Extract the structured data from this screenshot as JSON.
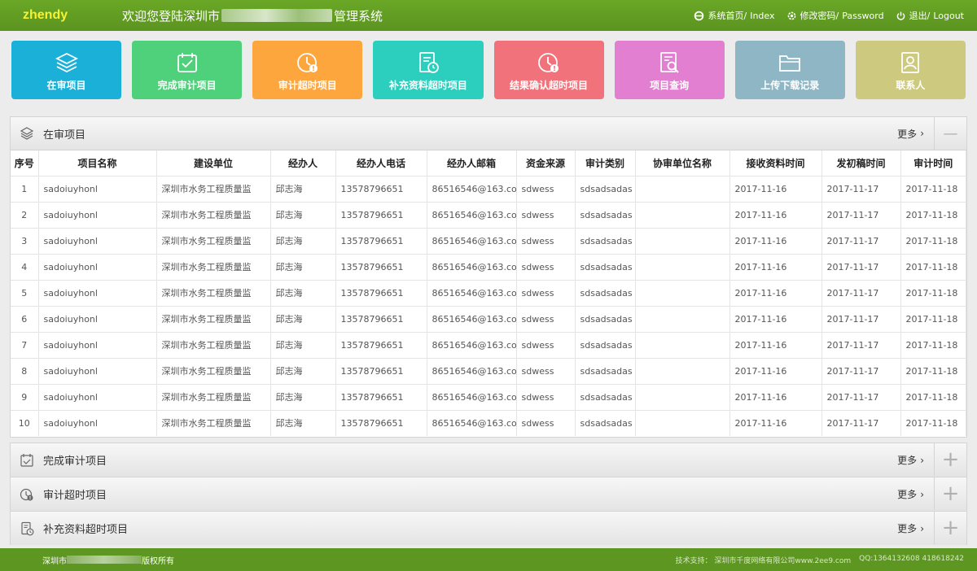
{
  "header": {
    "brand": "zhendy",
    "title_prefix": "欢迎您登陆深圳市",
    "title_suffix": "管理系统",
    "links": [
      {
        "icon": "ie-icon",
        "zh": "系统首页/",
        "en": " Index"
      },
      {
        "icon": "gear-icon",
        "zh": "修改密码/",
        "en": " Password"
      },
      {
        "icon": "power-icon",
        "zh": "退出/",
        "en": " Logout"
      }
    ]
  },
  "tiles": [
    {
      "label": "在审项目",
      "icon": "layers-icon",
      "color": "#1ab0d8"
    },
    {
      "label": "完成审计项目",
      "icon": "calendar-check-icon",
      "color": "#4fd07a"
    },
    {
      "label": "审计超时项目",
      "icon": "clock-alert-icon",
      "color": "#fda63d"
    },
    {
      "label": "补充资料超时项目",
      "icon": "document-clock-icon",
      "color": "#2ccfbe"
    },
    {
      "label": "结果确认超时项目",
      "icon": "clock-alert-icon",
      "color": "#f2727b"
    },
    {
      "label": "项目查询",
      "icon": "document-search-icon",
      "color": "#e27fd0"
    },
    {
      "label": "上传下载记录",
      "icon": "folder-icon",
      "color": "#8fb6c4"
    },
    {
      "label": "联系人",
      "icon": "contact-icon",
      "color": "#cdc97f"
    }
  ],
  "main_panel": {
    "title": "在审项目",
    "more": "更多",
    "toggle": "—",
    "columns": [
      "序号",
      "项目名称",
      "建设单位",
      "经办人",
      "经办人电话",
      "经办人邮箱",
      "资金来源",
      "审计类别",
      "协审单位名称",
      "接收资料时间",
      "发初稿时间",
      "审计时间"
    ],
    "rows": [
      [
        "1",
        "sadoiuyhonl",
        "深圳市水务工程质量监",
        "邱志海",
        "13578796651",
        "86516546@163.co",
        "sdwess",
        "sdsadsadas",
        "",
        "2017-11-16",
        "2017-11-17",
        "2017-11-18"
      ],
      [
        "2",
        "sadoiuyhonl",
        "深圳市水务工程质量监",
        "邱志海",
        "13578796651",
        "86516546@163.co",
        "sdwess",
        "sdsadsadas",
        "",
        "2017-11-16",
        "2017-11-17",
        "2017-11-18"
      ],
      [
        "3",
        "sadoiuyhonl",
        "深圳市水务工程质量监",
        "邱志海",
        "13578796651",
        "86516546@163.co",
        "sdwess",
        "sdsadsadas",
        "",
        "2017-11-16",
        "2017-11-17",
        "2017-11-18"
      ],
      [
        "4",
        "sadoiuyhonl",
        "深圳市水务工程质量监",
        "邱志海",
        "13578796651",
        "86516546@163.co",
        "sdwess",
        "sdsadsadas",
        "",
        "2017-11-16",
        "2017-11-17",
        "2017-11-18"
      ],
      [
        "5",
        "sadoiuyhonl",
        "深圳市水务工程质量监",
        "邱志海",
        "13578796651",
        "86516546@163.co",
        "sdwess",
        "sdsadsadas",
        "",
        "2017-11-16",
        "2017-11-17",
        "2017-11-18"
      ],
      [
        "6",
        "sadoiuyhonl",
        "深圳市水务工程质量监",
        "邱志海",
        "13578796651",
        "86516546@163.co",
        "sdwess",
        "sdsadsadas",
        "",
        "2017-11-16",
        "2017-11-17",
        "2017-11-18"
      ],
      [
        "7",
        "sadoiuyhonl",
        "深圳市水务工程质量监",
        "邱志海",
        "13578796651",
        "86516546@163.co",
        "sdwess",
        "sdsadsadas",
        "",
        "2017-11-16",
        "2017-11-17",
        "2017-11-18"
      ],
      [
        "8",
        "sadoiuyhonl",
        "深圳市水务工程质量监",
        "邱志海",
        "13578796651",
        "86516546@163.co",
        "sdwess",
        "sdsadsadas",
        "",
        "2017-11-16",
        "2017-11-17",
        "2017-11-18"
      ],
      [
        "9",
        "sadoiuyhonl",
        "深圳市水务工程质量监",
        "邱志海",
        "13578796651",
        "86516546@163.co",
        "sdwess",
        "sdsadsadas",
        "",
        "2017-11-16",
        "2017-11-17",
        "2017-11-18"
      ],
      [
        "10",
        "sadoiuyhonl",
        "深圳市水务工程质量监",
        "邱志海",
        "13578796651",
        "86516546@163.co",
        "sdwess",
        "sdsadsadas",
        "",
        "2017-11-16",
        "2017-11-17",
        "2017-11-18"
      ]
    ]
  },
  "collapsed_panels": [
    {
      "title": "完成审计项目",
      "icon": "calendar-check-icon",
      "more": "更多",
      "toggle": "+"
    },
    {
      "title": "审计超时项目",
      "icon": "clock-alert-icon",
      "more": "更多",
      "toggle": "+"
    },
    {
      "title": "补充资料超时项目",
      "icon": "document-clock-icon",
      "more": "更多",
      "toggle": "+"
    }
  ],
  "footer": {
    "left_prefix": "深圳市",
    "left_suffix": "版权所有",
    "support": "技术支持： 深圳市千度网络有限公司www.2ee9.com",
    "qq": "QQ:1364132608 418618242"
  }
}
